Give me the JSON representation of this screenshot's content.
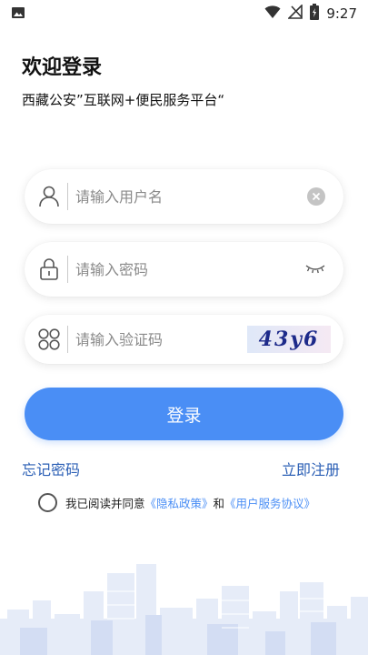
{
  "status_bar": {
    "time": "9:27"
  },
  "header": {
    "title": "欢迎登录",
    "subtitle": "西藏公安”互联网+便民服务平台“"
  },
  "form": {
    "username_placeholder": "请输入用户名",
    "password_placeholder": "请输入密码",
    "captcha_placeholder": "请输入验证码",
    "captcha_text": "43y6",
    "login_label": "登录"
  },
  "links": {
    "forgot_password": "忘记密码",
    "register": "立即注册"
  },
  "agreement": {
    "prefix": "我已阅读并同意",
    "privacy_policy": "《隐私政策》",
    "conjunction": "和",
    "user_agreement": "《用户服务协议》"
  },
  "colors": {
    "accent": "#4a8ef5",
    "link": "#2b5fb5",
    "skyline": "#dde6f6"
  }
}
